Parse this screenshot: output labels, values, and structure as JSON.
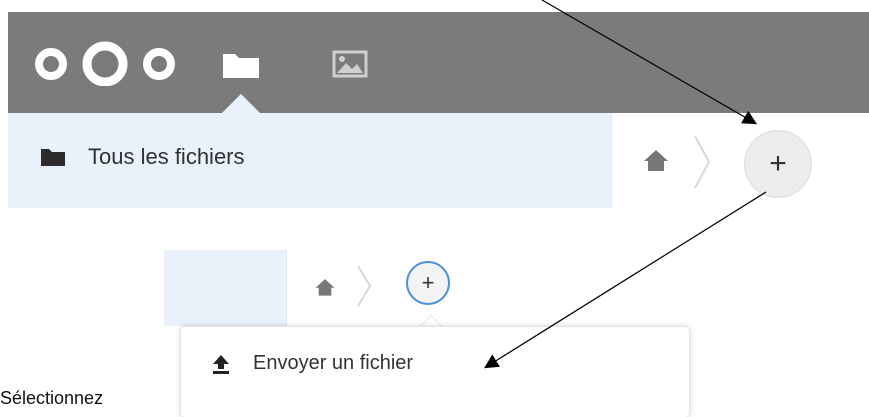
{
  "header": {
    "logo": "nextcloud-logo",
    "nav_items": [
      {
        "name": "files",
        "icon": "folder-icon",
        "active": true
      },
      {
        "name": "gallery",
        "icon": "image-icon",
        "active": false
      }
    ],
    "bg_color": "#7b7b7b"
  },
  "sidebar": {
    "items": [
      {
        "label": "Tous les fichiers",
        "icon": "folder-icon"
      }
    ],
    "bg_color": "#e9f1fb"
  },
  "breadcrumb": {
    "home_icon": "home-icon",
    "separator_icon": "chevron-right-icon",
    "new_button_icon": "plus-icon",
    "new_button_label": "+"
  },
  "menu": {
    "items": [
      {
        "label": "Envoyer un fichier",
        "icon": "upload-icon"
      }
    ]
  },
  "caption": "Sélectionnez",
  "accent_color": "#4a8ee0"
}
